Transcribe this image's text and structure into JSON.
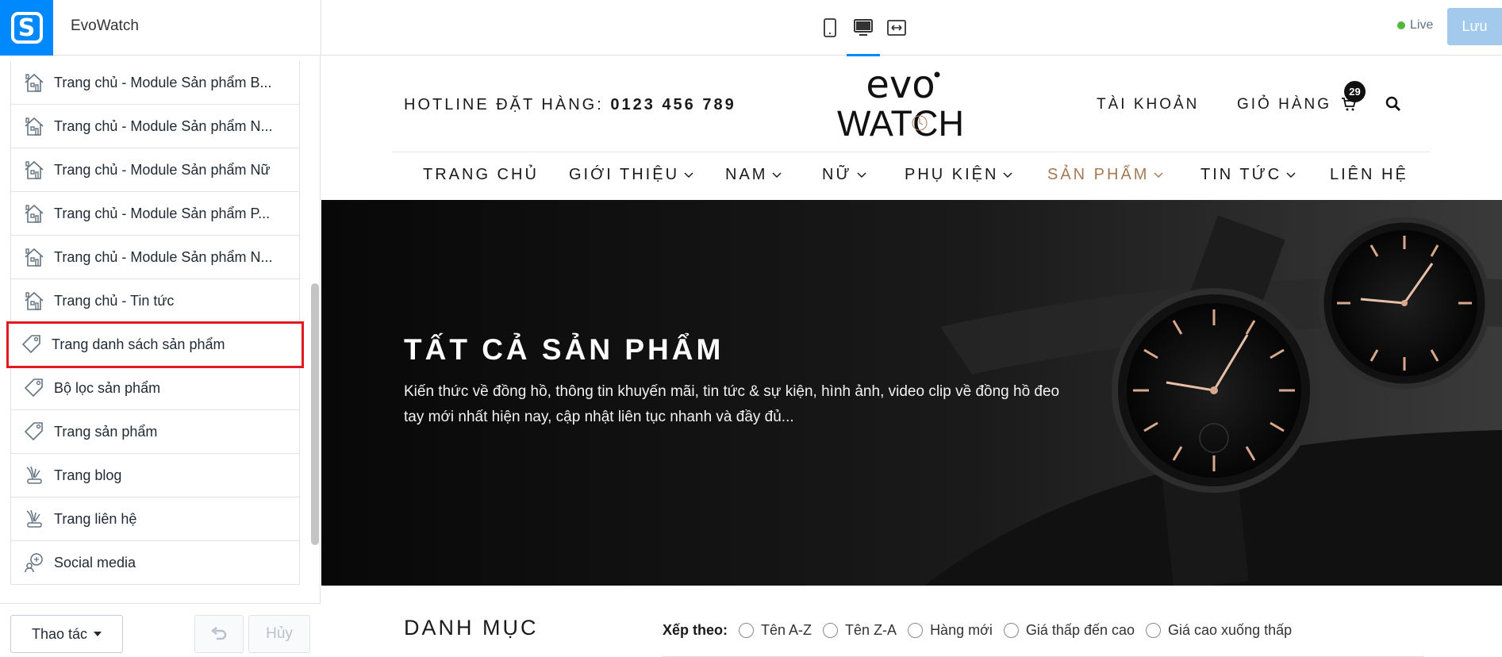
{
  "app": {
    "name": "EvoWatch",
    "logo_letter": "S"
  },
  "toolbar": {
    "live_label": "Live",
    "save_label": "Lưu",
    "devices": [
      "mobile-icon",
      "desktop-icon",
      "fullwidth-icon"
    ],
    "active_device": "desktop"
  },
  "sidebar": {
    "items": [
      {
        "label": "Trang chủ - Module Sản phẩm B...",
        "icon": "home-icon"
      },
      {
        "label": "Trang chủ - Module Sản phẩm N...",
        "icon": "home-icon"
      },
      {
        "label": "Trang chủ - Module Sản phẩm Nữ",
        "icon": "home-icon"
      },
      {
        "label": "Trang chủ - Module Sản phẩm P...",
        "icon": "home-icon"
      },
      {
        "label": "Trang chủ - Module Sản phẩm N...",
        "icon": "home-icon"
      },
      {
        "label": "Trang chủ - Tin tức",
        "icon": "home-icon"
      },
      {
        "label": "Trang danh sách sản phẩm",
        "icon": "tag-icon",
        "selected": true
      },
      {
        "label": "Bộ lọc sản phẩm",
        "icon": "tag-icon"
      },
      {
        "label": "Trang sản phẩm",
        "icon": "tag-icon"
      },
      {
        "label": "Trang blog",
        "icon": "blog-icon"
      },
      {
        "label": "Trang liên hệ",
        "icon": "blog-icon"
      },
      {
        "label": "Social media",
        "icon": "social-icon"
      }
    ],
    "actions_label": "Thao tác",
    "cancel_label": "Hủy"
  },
  "preview": {
    "hotline_prefix": "HOTLINE ĐẶT HÀNG:",
    "hotline_number": "0123 456 789",
    "brand_top": "evo",
    "brand_bottom": "WATCH",
    "account_label": "TÀI KHOẢN",
    "cart_label": "GIỎ HÀNG",
    "cart_count": "29",
    "nav": [
      {
        "label": "TRANG CHỦ",
        "dropdown": false
      },
      {
        "label": "GIỚI THIỆU",
        "dropdown": true
      },
      {
        "label": "NAM",
        "dropdown": true
      },
      {
        "label": "NỮ",
        "dropdown": true
      },
      {
        "label": "PHỤ KIỆN",
        "dropdown": true
      },
      {
        "label": "SẢN PHẨM",
        "dropdown": true,
        "active": true
      },
      {
        "label": "TIN TỨC",
        "dropdown": true
      },
      {
        "label": "LIÊN HỆ",
        "dropdown": false
      }
    ],
    "hero": {
      "title": "TẤT CẢ SẢN PHẨM",
      "description": "Kiến thức về đồng hồ, thông tin khuyến mãi, tin tức & sự kiện, hình ảnh, video clip về đồng hồ đeo tay mới nhất hiện nay, cập nhật liên tục nhanh và đầy đủ..."
    },
    "category_title": "DANH MỤC",
    "sort_label": "Xếp theo:",
    "sort_options": [
      "Tên A-Z",
      "Tên Z-A",
      "Hàng mới",
      "Giá thấp đến cao",
      "Giá cao xuống thấp"
    ]
  },
  "colors": {
    "accent": "#0088ff",
    "nav_active": "#a37b56",
    "highlight": "#e4191f",
    "live": "#50b83c"
  }
}
